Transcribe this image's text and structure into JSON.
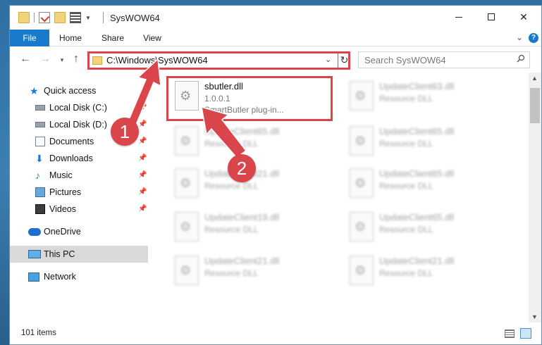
{
  "window": {
    "title": "SysWOW64",
    "controls": {
      "minimize": "",
      "maximize": "",
      "close": "✕"
    }
  },
  "ribbon": {
    "tabs": [
      "File",
      "Home",
      "Share",
      "View"
    ],
    "expand": "⌄",
    "help": "?"
  },
  "navigation": {
    "back": "←",
    "forward": "→",
    "recent": "▾",
    "up": "↑",
    "address": "C:\\Windows\\SysWOW64",
    "address_dropdown": "⌄",
    "refresh": "↻",
    "search_placeholder": "Search SysWOW64"
  },
  "nav_pane": {
    "items": [
      {
        "label": "Quick access",
        "icon": "star-icon",
        "pinned": false
      },
      {
        "label": "Local Disk (C:)",
        "icon": "drive-icon",
        "pinned": true
      },
      {
        "label": "Local Disk (D:)",
        "icon": "drive-icon",
        "pinned": true
      },
      {
        "label": "Documents",
        "icon": "documents-icon",
        "pinned": true
      },
      {
        "label": "Downloads",
        "icon": "download-icon",
        "pinned": true
      },
      {
        "label": "Music",
        "icon": "music-icon",
        "pinned": true
      },
      {
        "label": "Pictures",
        "icon": "pictures-icon",
        "pinned": true
      },
      {
        "label": "Videos",
        "icon": "videos-icon",
        "pinned": true
      },
      {
        "label": "OneDrive",
        "icon": "cloud-icon",
        "pinned": false
      },
      {
        "label": "This PC",
        "icon": "computer-icon",
        "pinned": false,
        "selected": true
      },
      {
        "label": "Network",
        "icon": "network-icon",
        "pinned": false
      }
    ],
    "pin_glyph": "📌"
  },
  "files": {
    "highlighted": {
      "name": "sbutler.dll",
      "version": "1.0.0.1",
      "description": "SmartButler plug-in..."
    },
    "blurred": [
      {
        "name": "UpdateClient63.dll",
        "type": "Resource DLL"
      },
      {
        "name": "UpdateClient65.dll",
        "type": "Resource DLL"
      },
      {
        "name": "UpdateClient65.dll",
        "type": "Resource DLL"
      },
      {
        "name": "UpdateClient21.dll",
        "type": "Resource DLL"
      },
      {
        "name": "UpdateClient65.dll",
        "type": "Resource DLL"
      },
      {
        "name": "UpdateClient19.dll",
        "type": "Resource DLL"
      },
      {
        "name": "UpdateClient65.dll",
        "type": "Resource DLL"
      },
      {
        "name": "UpdateClient21.dll",
        "type": "Resource DLL"
      },
      {
        "name": "UpdateClient21.dll",
        "type": "Resource DLL"
      }
    ]
  },
  "status": {
    "item_count": "101 items"
  },
  "annotations": {
    "step1": "1",
    "step2": "2",
    "color": "#d9454a"
  }
}
